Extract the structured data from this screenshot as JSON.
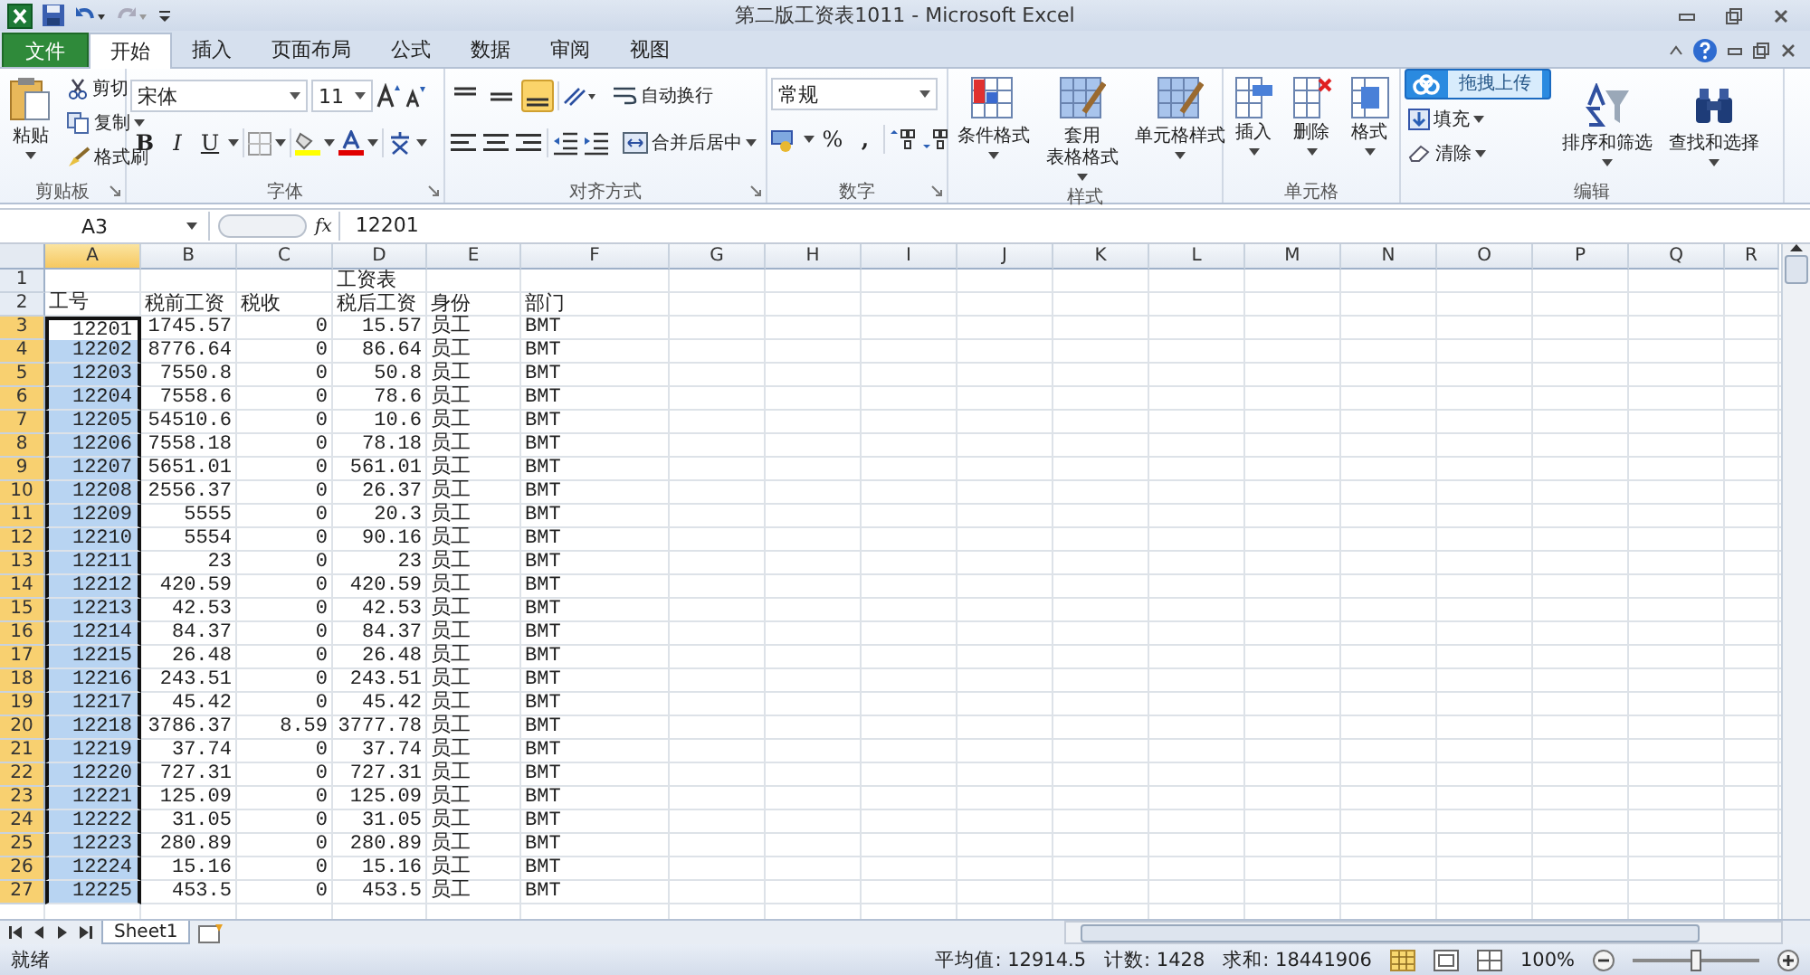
{
  "window": {
    "title": "第二版工资表1011 - Microsoft Excel"
  },
  "tabs": [
    {
      "label": "文件",
      "kind": "file",
      "selected": false
    },
    {
      "label": "开始",
      "kind": "tab",
      "selected": true
    },
    {
      "label": "插入",
      "kind": "tab",
      "selected": false
    },
    {
      "label": "页面布局",
      "kind": "tab",
      "selected": false
    },
    {
      "label": "公式",
      "kind": "tab",
      "selected": false
    },
    {
      "label": "数据",
      "kind": "tab",
      "selected": false
    },
    {
      "label": "审阅",
      "kind": "tab",
      "selected": false
    },
    {
      "label": "视图",
      "kind": "tab",
      "selected": false
    }
  ],
  "ribbon": {
    "clipboard": {
      "label": "剪贴板",
      "paste": "粘贴",
      "cut": "剪切",
      "copy": "复制",
      "format_painter": "格式刷"
    },
    "font": {
      "label": "字体",
      "font_name": "宋体",
      "font_size": "11",
      "bold": "B",
      "italic": "I",
      "underline": "U"
    },
    "alignment": {
      "label": "对齐方式",
      "wrap": "自动换行",
      "merge": "合并后居中",
      "vertical_align": [
        {
          "selected": false
        },
        {
          "selected": false
        },
        {
          "selected": true
        }
      ]
    },
    "number": {
      "label": "数字",
      "format": "常规",
      "percent": "%",
      "comma": ","
    },
    "styles": {
      "label": "样式",
      "buttons": [
        {
          "lines": [
            "条件格式"
          ]
        },
        {
          "lines": [
            "套用",
            "表格格式"
          ]
        },
        {
          "lines": [
            "单元格样式"
          ]
        }
      ]
    },
    "cells": {
      "label": "单元格",
      "buttons": [
        "插入",
        "删除",
        "格式"
      ]
    },
    "editing": {
      "label": "编辑",
      "upload": "拖拽上传",
      "fill": "填充",
      "clear": "清除",
      "sort": "排序和筛选",
      "find": "查找和选择"
    }
  },
  "formula_bar": {
    "name_box": "A3",
    "fx": "fx",
    "value": "12201"
  },
  "columns": [
    {
      "label": "A",
      "selected": true
    },
    {
      "label": "B",
      "selected": false
    },
    {
      "label": "C",
      "selected": false
    },
    {
      "label": "D",
      "selected": false
    },
    {
      "label": "E",
      "selected": false
    },
    {
      "label": "F",
      "selected": false
    },
    {
      "label": "G",
      "selected": false
    },
    {
      "label": "H",
      "selected": false
    },
    {
      "label": "I",
      "selected": false
    },
    {
      "label": "J",
      "selected": false
    },
    {
      "label": "K",
      "selected": false
    },
    {
      "label": "L",
      "selected": false
    },
    {
      "label": "M",
      "selected": false
    },
    {
      "label": "N",
      "selected": false
    },
    {
      "label": "O",
      "selected": false
    },
    {
      "label": "P",
      "selected": false
    },
    {
      "label": "Q",
      "selected": false
    },
    {
      "label": "R",
      "selected": false
    }
  ],
  "rows": [
    {
      "n": "1",
      "kind": "title",
      "selected": false,
      "active": false,
      "cells": [
        "",
        "",
        "",
        "工资表",
        "",
        ""
      ]
    },
    {
      "n": "2",
      "kind": "header",
      "selected": false,
      "active": false,
      "cells": [
        "工号",
        "税前工资",
        "税收",
        "税后工资",
        "身份",
        "部门"
      ]
    },
    {
      "n": "3",
      "kind": "data",
      "selected": true,
      "active": true,
      "cells": [
        "12201",
        "1745.57",
        "0",
        "15.57",
        "员工",
        "BMT"
      ]
    },
    {
      "n": "4",
      "kind": "data",
      "selected": true,
      "active": false,
      "cells": [
        "12202",
        "8776.64",
        "0",
        "86.64",
        "员工",
        "BMT"
      ]
    },
    {
      "n": "5",
      "kind": "data",
      "selected": true,
      "active": false,
      "cells": [
        "12203",
        "7550.8",
        "0",
        "50.8",
        "员工",
        "BMT"
      ]
    },
    {
      "n": "6",
      "kind": "data",
      "selected": true,
      "active": false,
      "cells": [
        "12204",
        "7558.6",
        "0",
        "78.6",
        "员工",
        "BMT"
      ]
    },
    {
      "n": "7",
      "kind": "data",
      "selected": true,
      "active": false,
      "cells": [
        "12205",
        "54510.6",
        "0",
        "10.6",
        "员工",
        "BMT"
      ]
    },
    {
      "n": "8",
      "kind": "data",
      "selected": true,
      "active": false,
      "cells": [
        "12206",
        "7558.18",
        "0",
        "78.18",
        "员工",
        "BMT"
      ]
    },
    {
      "n": "9",
      "kind": "data",
      "selected": true,
      "active": false,
      "cells": [
        "12207",
        "5651.01",
        "0",
        "561.01",
        "员工",
        "BMT"
      ]
    },
    {
      "n": "10",
      "kind": "data",
      "selected": true,
      "active": false,
      "cells": [
        "12208",
        "2556.37",
        "0",
        "26.37",
        "员工",
        "BMT"
      ]
    },
    {
      "n": "11",
      "kind": "data",
      "selected": true,
      "active": false,
      "cells": [
        "12209",
        "5555",
        "0",
        "20.3",
        "员工",
        "BMT"
      ]
    },
    {
      "n": "12",
      "kind": "data",
      "selected": true,
      "active": false,
      "cells": [
        "12210",
        "5554",
        "0",
        "90.16",
        "员工",
        "BMT"
      ]
    },
    {
      "n": "13",
      "kind": "data",
      "selected": true,
      "active": false,
      "cells": [
        "12211",
        "23",
        "0",
        "23",
        "员工",
        "BMT"
      ]
    },
    {
      "n": "14",
      "kind": "data",
      "selected": true,
      "active": false,
      "cells": [
        "12212",
        "420.59",
        "0",
        "420.59",
        "员工",
        "BMT"
      ]
    },
    {
      "n": "15",
      "kind": "data",
      "selected": true,
      "active": false,
      "cells": [
        "12213",
        "42.53",
        "0",
        "42.53",
        "员工",
        "BMT"
      ]
    },
    {
      "n": "16",
      "kind": "data",
      "selected": true,
      "active": false,
      "cells": [
        "12214",
        "84.37",
        "0",
        "84.37",
        "员工",
        "BMT"
      ]
    },
    {
      "n": "17",
      "kind": "data",
      "selected": true,
      "active": false,
      "cells": [
        "12215",
        "26.48",
        "0",
        "26.48",
        "员工",
        "BMT"
      ]
    },
    {
      "n": "18",
      "kind": "data",
      "selected": true,
      "active": false,
      "cells": [
        "12216",
        "243.51",
        "0",
        "243.51",
        "员工",
        "BMT"
      ]
    },
    {
      "n": "19",
      "kind": "data",
      "selected": true,
      "active": false,
      "cells": [
        "12217",
        "45.42",
        "0",
        "45.42",
        "员工",
        "BMT"
      ]
    },
    {
      "n": "20",
      "kind": "data",
      "selected": true,
      "active": false,
      "cells": [
        "12218",
        "3786.37",
        "8.59",
        "3777.78",
        "员工",
        "BMT"
      ]
    },
    {
      "n": "21",
      "kind": "data",
      "selected": true,
      "active": false,
      "cells": [
        "12219",
        "37.74",
        "0",
        "37.74",
        "员工",
        "BMT"
      ]
    },
    {
      "n": "22",
      "kind": "data",
      "selected": true,
      "active": false,
      "cells": [
        "12220",
        "727.31",
        "0",
        "727.31",
        "员工",
        "BMT"
      ]
    },
    {
      "n": "23",
      "kind": "data",
      "selected": true,
      "active": false,
      "cells": [
        "12221",
        "125.09",
        "0",
        "125.09",
        "员工",
        "BMT"
      ]
    },
    {
      "n": "24",
      "kind": "data",
      "selected": true,
      "active": false,
      "cells": [
        "12222",
        "31.05",
        "0",
        "31.05",
        "员工",
        "BMT"
      ]
    },
    {
      "n": "25",
      "kind": "data",
      "selected": true,
      "active": false,
      "cells": [
        "12223",
        "280.89",
        "0",
        "280.89",
        "员工",
        "BMT"
      ]
    },
    {
      "n": "26",
      "kind": "data",
      "selected": true,
      "active": false,
      "cells": [
        "12224",
        "15.16",
        "0",
        "15.16",
        "员工",
        "BMT"
      ]
    },
    {
      "n": "27",
      "kind": "data",
      "selected": true,
      "active": false,
      "cells": [
        "12225",
        "453.5",
        "0",
        "453.5",
        "员工",
        "BMT"
      ]
    }
  ],
  "sheet_tabs": [
    {
      "label": "Sheet1",
      "selected": true
    }
  ],
  "status_bar": {
    "ready": "就绪",
    "average": "平均值: 12914.5",
    "count": "计数: 1428",
    "sum": "求和: 18441906",
    "zoom": "100%",
    "zoom_slider": {
      "level": 0.5
    }
  }
}
